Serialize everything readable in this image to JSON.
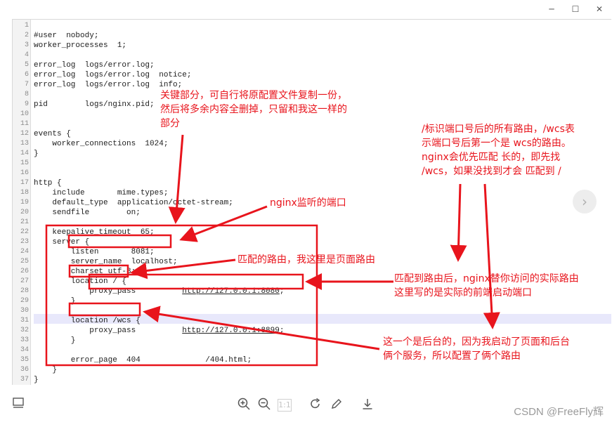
{
  "window": {
    "minimize_glyph": "─",
    "maximize_glyph": "☐",
    "close_glyph": "✕"
  },
  "editor": {
    "lines": [
      {
        "num": "1",
        "text": ""
      },
      {
        "num": "2",
        "text": "#user  nobody;"
      },
      {
        "num": "3",
        "text": "worker_processes  1;"
      },
      {
        "num": "4",
        "text": ""
      },
      {
        "num": "5",
        "text": "error_log  logs/error.log;"
      },
      {
        "num": "6",
        "text": "error_log  logs/error.log  notice;"
      },
      {
        "num": "7",
        "text": "error_log  logs/error.log  info;"
      },
      {
        "num": "8",
        "text": ""
      },
      {
        "num": "9",
        "text": "pid        logs/nginx.pid;"
      },
      {
        "num": "10",
        "text": ""
      },
      {
        "num": "11",
        "text": ""
      },
      {
        "num": "12",
        "text": "events {"
      },
      {
        "num": "13",
        "text": "    worker_connections  1024;"
      },
      {
        "num": "14",
        "text": "}"
      },
      {
        "num": "15",
        "text": ""
      },
      {
        "num": "16",
        "text": ""
      },
      {
        "num": "17",
        "text": "http {"
      },
      {
        "num": "18",
        "text": "    include       mime.types;"
      },
      {
        "num": "19",
        "text": "    default_type  application/octet-stream;"
      },
      {
        "num": "20",
        "text": "    sendfile        on;"
      },
      {
        "num": "21",
        "text": ""
      },
      {
        "num": "22",
        "text": "    keepalive_timeout  65;"
      },
      {
        "num": "23",
        "text": "    server {"
      },
      {
        "num": "24",
        "text": "        listen       8081;"
      },
      {
        "num": "25",
        "text": "        server_name  localhost;"
      },
      {
        "num": "26",
        "text": "        charset utf-8;"
      },
      {
        "num": "27",
        "text": "        location / {"
      },
      {
        "num": "28",
        "text": "            proxy_pass          http://127.0.0.1:8080;"
      },
      {
        "num": "29",
        "text": "        }"
      },
      {
        "num": "30",
        "text": ""
      },
      {
        "num": "31",
        "text": "        location /wcs {"
      },
      {
        "num": "32",
        "text": "            proxy_pass          http://127.0.0.1:8899;"
      },
      {
        "num": "33",
        "text": "        }"
      },
      {
        "num": "34",
        "text": ""
      },
      {
        "num": "35",
        "text": "        error_page  404              /404.html;"
      },
      {
        "num": "36",
        "text": "    }"
      },
      {
        "num": "37",
        "text": "}"
      }
    ]
  },
  "annotations": {
    "key_part": "关键部分，可自行将原配置文件复制一份，\n然后将多余内容全删掉，只留和我这一样的\n部分",
    "nginx_port": "nginx监听的端口",
    "matched_route": "匹配的路由，我这里是页面路由",
    "slash_note": "/标识端口号后的所有路由，/wcs表\n示端口号后第一个是 wcs的路由。\nnginx会优先匹配 长的，即先找\n/wcs，如果没找到才会 匹配到 /",
    "actual_route": "匹配到路由后，nginx替你访问的实际路由\n这里写的是实际的前端启动端口",
    "backend_note": "这一个是后台的，因为我启动了页面和后台\n俩个服务，所以配置了俩个路由"
  },
  "toolbar": {
    "layout_icon": "sidebar-layout",
    "zoom_in_icon": "zoom-in",
    "zoom_out_icon": "zoom-out",
    "actual_size_label": "1:1",
    "rotate_icon": "rotate",
    "edit_icon": "pencil",
    "download_icon": "download"
  },
  "watermark": "CSDN @FreeFly辉",
  "colors": {
    "annotation": "#e8141c",
    "line_highlight": "#e8e8fb"
  }
}
